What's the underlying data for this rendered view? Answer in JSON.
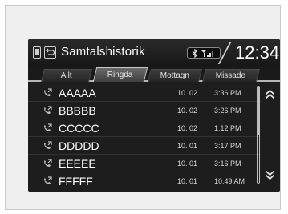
{
  "header": {
    "title": "Samtalshistorik",
    "clock": "12:34"
  },
  "tabs": [
    {
      "label": "Allt",
      "active": false
    },
    {
      "label": "Ringda",
      "active": true
    },
    {
      "label": "Mottagn",
      "active": false
    },
    {
      "label": "Missade",
      "active": false
    }
  ],
  "calls": [
    {
      "name": "AAAAA",
      "date": "10. 02",
      "time": "3:36 PM"
    },
    {
      "name": "BBBBB",
      "date": "10. 02",
      "time": "3:26 PM"
    },
    {
      "name": "CCCCC",
      "date": "10. 02",
      "time": "1:12 PM"
    },
    {
      "name": "DDDDD",
      "date": "10. 01",
      "time": "3:17 PM"
    },
    {
      "name": "EEEEE",
      "date": "10. 01",
      "time": "3:16 PM"
    },
    {
      "name": "FFFFF",
      "date": "10. 01",
      "time": "10:49 AM"
    }
  ],
  "icons": {
    "phone": "phone-icon",
    "back": "back-arrow-icon",
    "bluetooth": "bluetooth-icon",
    "signal": "signal-strength-icon",
    "call_type": "outgoing-call-icon",
    "scroll_up": "double-chevron-up-icon",
    "scroll_down": "double-chevron-down-icon"
  },
  "colors": {
    "screen_bg": "#1d1d1d",
    "text": "#ffffff",
    "icon": "#bdbdbd"
  }
}
